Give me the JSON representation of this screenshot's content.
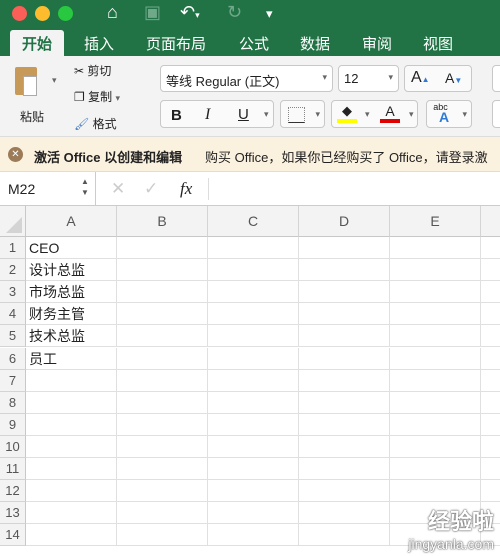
{
  "toolbar": {
    "icons": [
      "home-icon",
      "save-icon",
      "undo-icon",
      "redo-icon",
      "customize-icon"
    ]
  },
  "tabs": [
    "开始",
    "插入",
    "页面布局",
    "公式",
    "数据",
    "审阅",
    "视图"
  ],
  "ribbon": {
    "paste": "粘贴",
    "cut": "剪切",
    "copy": "复制",
    "format": "格式",
    "font": "等线 Regular (正文)",
    "size": "12",
    "bold": "B",
    "italic": "I",
    "underline": "U",
    "font_color": "A",
    "phonetic": "abc",
    "highlight_color": "#ffff00",
    "text_color": "#e00000"
  },
  "message": {
    "title": "激活 Office 以创建和编辑",
    "text": "购买 Office，如果你已经购买了 Office，请登录激"
  },
  "formula": {
    "name_box": "M22",
    "fx": "fx",
    "value": ""
  },
  "columns": [
    "A",
    "B",
    "C",
    "D",
    "E"
  ],
  "rows": [
    "1",
    "2",
    "3",
    "4",
    "5",
    "6",
    "7",
    "8",
    "9",
    "10",
    "11",
    "12",
    "13",
    "14"
  ],
  "cells_a": [
    "CEO",
    "设计总监",
    "市场总监",
    "财务主管",
    "技术总监",
    "员工"
  ],
  "watermark": {
    "title": "经验啦",
    "url": "jingyanla.com"
  }
}
